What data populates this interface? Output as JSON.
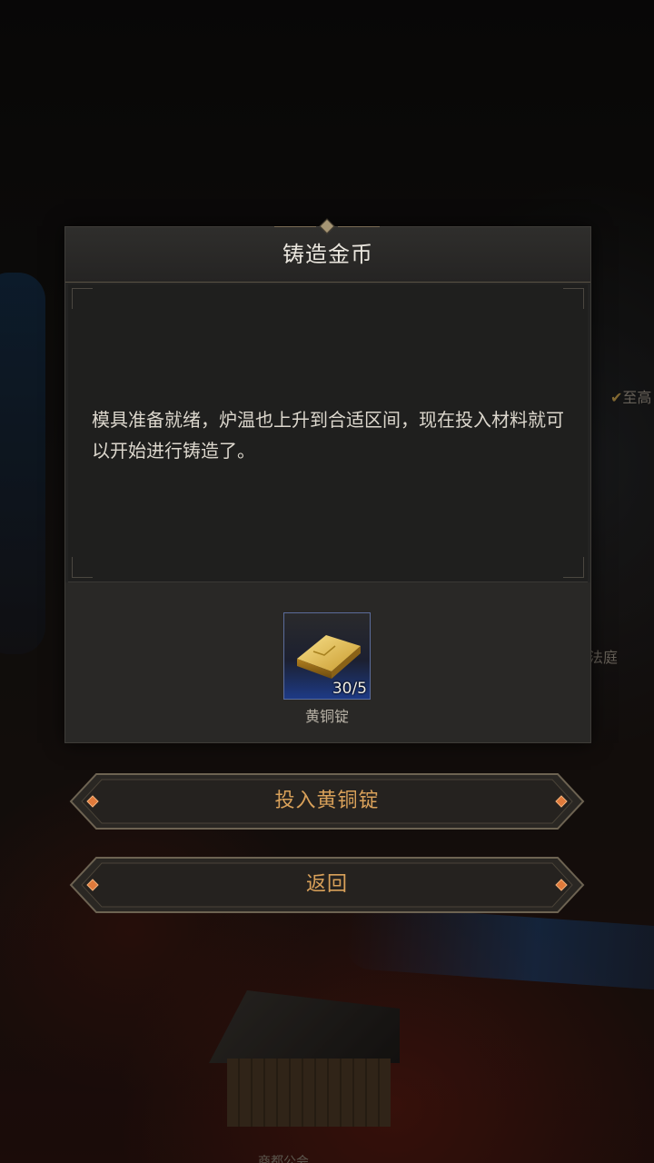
{
  "dialog": {
    "title": "铸造金币",
    "message": "模具准备就绪，炉温也上升到合适区间，现在投入材料就可以开始进行铸造了。",
    "item": {
      "name": "黄铜锭",
      "count": "30/5",
      "icon": "gold-ingot-icon"
    }
  },
  "buttons": {
    "submit_label": "投入黄铜锭",
    "back_label": "返回"
  },
  "background": {
    "tag_right_top": "至高",
    "tag_right_mid": "法庭",
    "tag_bottom": "商都公会"
  },
  "colors": {
    "button_text": "#d9a15a",
    "title_text": "#ebe7df",
    "slot_rarity": "#1d3a86"
  }
}
